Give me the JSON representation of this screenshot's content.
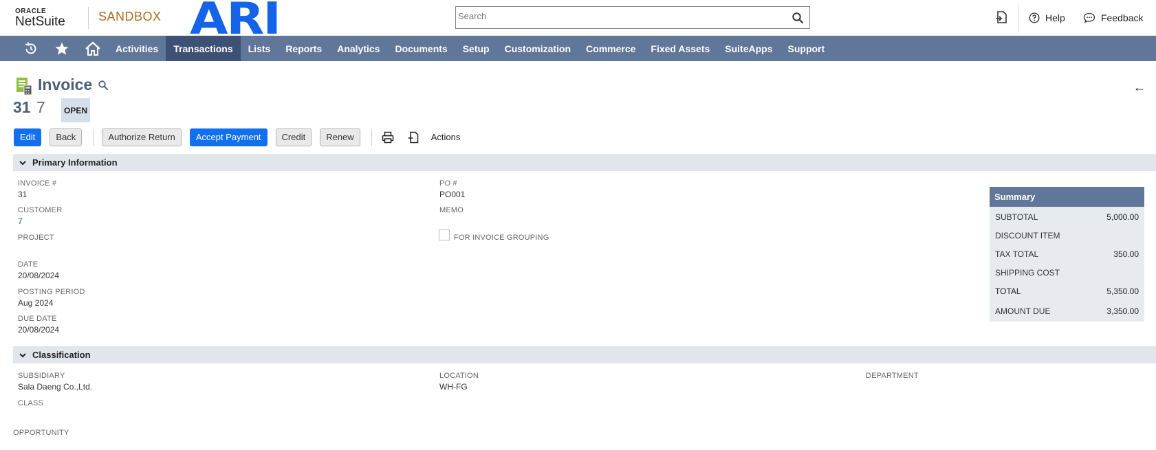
{
  "header": {
    "logo_top": "ORACLE",
    "logo_bottom": "NetSuite",
    "environment": "SANDBOX",
    "brand": "ARI",
    "search_placeholder": "Search",
    "help_label": "Help",
    "feedback_label": "Feedback"
  },
  "nav": {
    "items": [
      "Activities",
      "Transactions",
      "Lists",
      "Reports",
      "Analytics",
      "Documents",
      "Setup",
      "Customization",
      "Commerce",
      "Fixed Assets",
      "SuiteApps",
      "Support"
    ],
    "active": "Transactions"
  },
  "page": {
    "title": "Invoice",
    "record_number": "31",
    "record_customer": "7",
    "status": "OPEN"
  },
  "toolbar": {
    "edit": "Edit",
    "back": "Back",
    "authorize_return": "Authorize Return",
    "accept_payment": "Accept Payment",
    "credit": "Credit",
    "renew": "Renew",
    "actions": "Actions"
  },
  "primary": {
    "section_title": "Primary Information",
    "invoice_label": "INVOICE #",
    "invoice_value": "31",
    "customer_label": "CUSTOMER",
    "customer_value": "7",
    "project_label": "PROJECT",
    "date_label": "DATE",
    "date_value": "20/08/2024",
    "posting_period_label": "POSTING PERIOD",
    "posting_period_value": "Aug 2024",
    "due_date_label": "DUE DATE",
    "due_date_value": "20/08/2024",
    "po_label": "PO #",
    "po_value": "PO001",
    "memo_label": "MEMO",
    "grouping_label": "FOR INVOICE GROUPING"
  },
  "summary": {
    "title": "Summary",
    "subtotal_label": "SUBTOTAL",
    "subtotal_value": "5,000.00",
    "discount_label": "DISCOUNT ITEM",
    "tax_label": "TAX TOTAL",
    "tax_value": "350.00",
    "shipping_label": "SHIPPING COST",
    "total_label": "TOTAL",
    "total_value": "5,350.00",
    "amount_due_label": "AMOUNT DUE",
    "amount_due_value": "3,350.00"
  },
  "classification": {
    "section_title": "Classification",
    "subsidiary_label": "SUBSIDIARY",
    "subsidiary_value": "Sala Daeng Co.,Ltd.",
    "location_label": "LOCATION",
    "location_value": "WH-FG",
    "department_label": "DEPARTMENT",
    "class_label": "CLASS"
  },
  "other": {
    "opportunity_label": "OPPORTUNITY"
  },
  "colors": {
    "nav_bg": "#607799",
    "nav_active": "#3d5175",
    "primary_button": "#1170ee",
    "sandbox": "#b06a1f",
    "brand": "#1463e8",
    "section_bg": "#e1e6ed"
  }
}
